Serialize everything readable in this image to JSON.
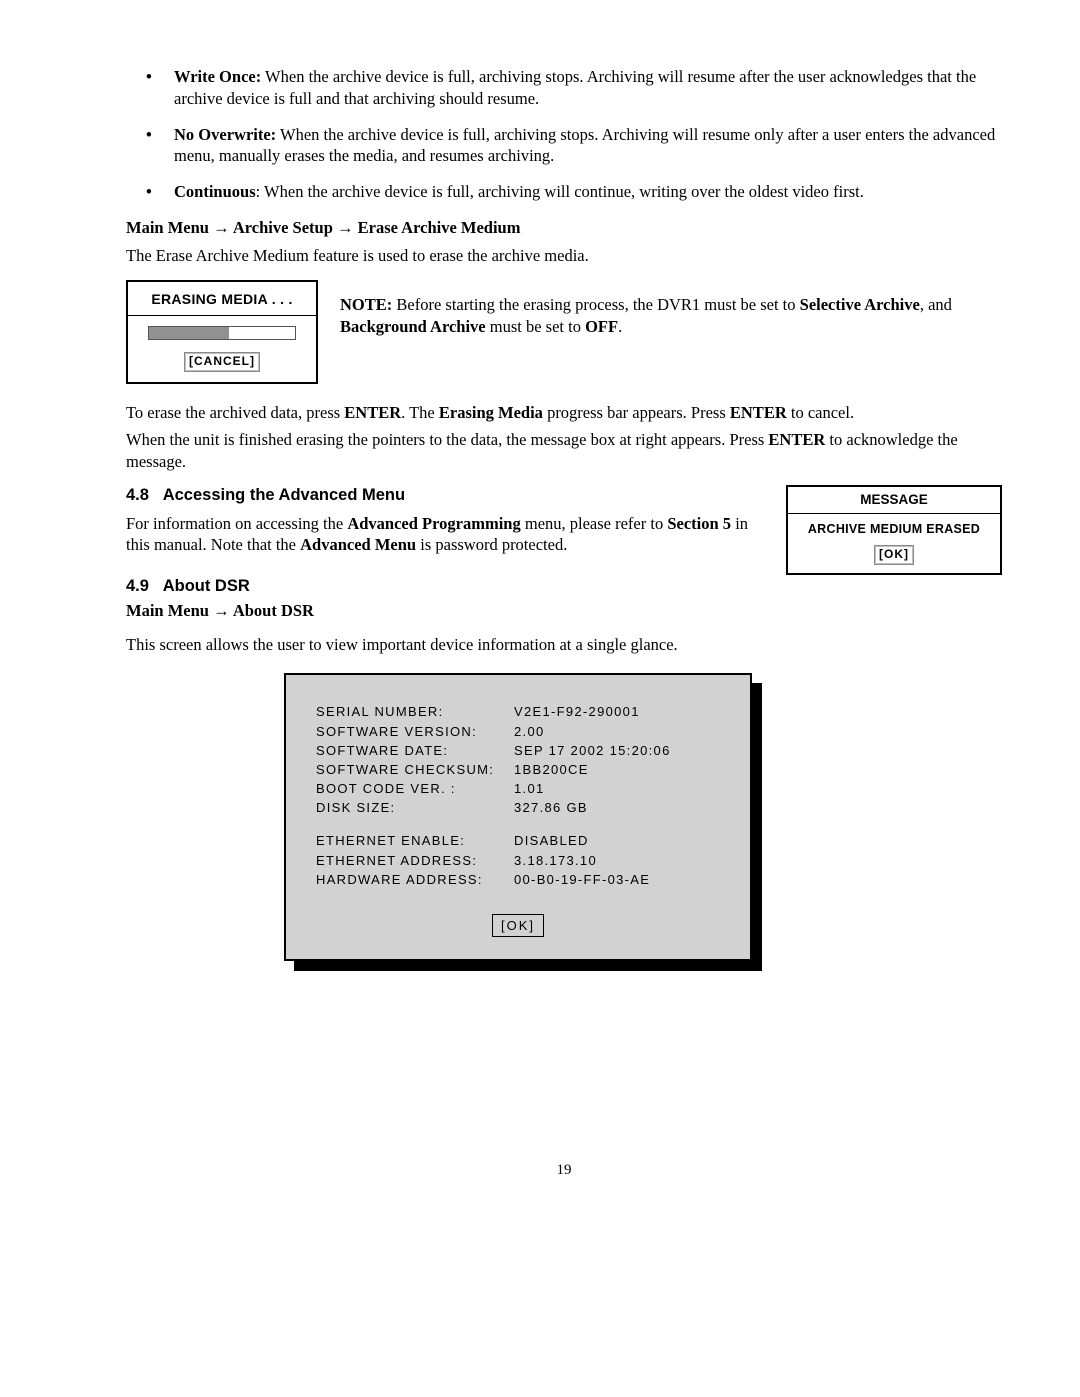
{
  "bullets": [
    {
      "label": "Write Once:",
      "text": "When the archive device is full, archiving stops. Archiving will resume after the user acknowledges that the archive device is full and that archiving should resume."
    },
    {
      "label": "No Overwrite:",
      "text": "When the archive device is full, archiving stops. Archiving will resume only after a user enters the advanced menu, manually erases the media, and resumes archiving."
    },
    {
      "label": "Continuous:",
      "cont_sep": ": ",
      "text": "When the archive device is full, archiving will continue, writing over the oldest video first."
    }
  ],
  "breadcrumb1": {
    "a": "Main Menu",
    "b": "Archive Setup",
    "c": "Erase Archive Medium"
  },
  "erase_intro": "The Erase Archive Medium feature is used to erase the archive media.",
  "dlg_erase": {
    "title": "ERASING MEDIA . . .",
    "cancel": "[CANCEL]"
  },
  "note": {
    "label": "NOTE:",
    "t1": "Before starting the erasing process, the DVR1 must be set to ",
    "sel": "Selective Archive",
    "t2": ", and ",
    "bg": "Background Archive",
    "t3": " must be set to ",
    "off": "OFF",
    "t4": "."
  },
  "erase_p1a": "To erase the archived data, press ",
  "erase_p1_enter": "ENTER",
  "erase_p1b": ". The ",
  "erase_p1_em": "Erasing Media",
  "erase_p1c": " progress bar appears. Press ",
  "erase_p1d": " to cancel.",
  "erase_p2a": "When the unit is finished erasing the pointers to the data, the message box at right appears. Press ",
  "erase_p2b": " to acknowledge the message.",
  "sec48": {
    "num": "4.8",
    "title": "Accessing the Advanced Menu"
  },
  "sec48_p_a": "For information on accessing the ",
  "sec48_p_b": "Advanced Programming",
  "sec48_p_c": " menu, please refer to ",
  "sec48_p_d": "Section 5",
  "sec48_p_e": " in this manual. Note that the ",
  "sec48_p_f": "Advanced Menu",
  "sec48_p_g": " is password protected.",
  "dlg_msg": {
    "title": "MESSAGE",
    "line": "ARCHIVE MEDIUM ERASED",
    "ok": "[OK]"
  },
  "sec49": {
    "num": "4.9",
    "title": "About DSR"
  },
  "breadcrumb2": {
    "a": "Main Menu",
    "b": "About DSR"
  },
  "about_intro": "This screen allows the user to view important device information at a single glance.",
  "about": {
    "rows1": [
      {
        "k": "SERIAL NUMBER:",
        "v": "V2E1-F92-290001"
      },
      {
        "k": "SOFTWARE VERSION:",
        "v": "2.00"
      },
      {
        "k": "SOFTWARE DATE:",
        "v": "SEP 17 2002  15:20:06"
      },
      {
        "k": "SOFTWARE CHECKSUM:",
        "v": "1BB200CE"
      },
      {
        "k": "BOOT CODE VER. :",
        "v": "1.01"
      },
      {
        "k": "DISK SIZE:",
        "v": "327.86 GB"
      }
    ],
    "rows2": [
      {
        "k": "ETHERNET ENABLE:",
        "v": "DISABLED"
      },
      {
        "k": "ETHERNET ADDRESS:",
        "v": "3.18.173.10"
      },
      {
        "k": "HARDWARE ADDRESS:",
        "v": "00-B0-19-FF-03-AE"
      }
    ],
    "ok": "[OK]"
  },
  "arrow": "→",
  "page_number": "19"
}
